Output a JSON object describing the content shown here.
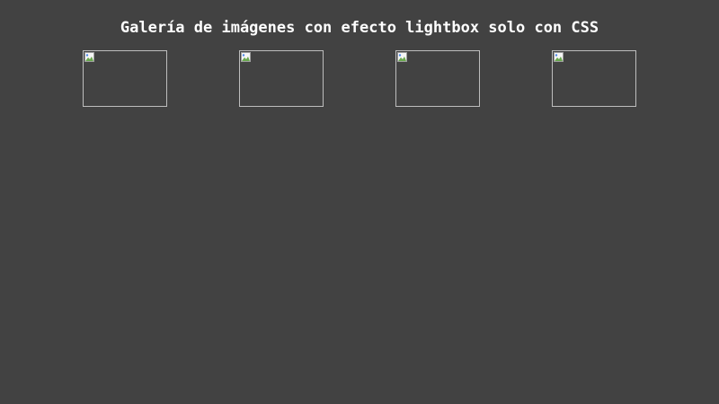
{
  "page": {
    "title": "Galería de imágenes con efecto lightbox solo con CSS",
    "background_color": "#424242",
    "text_color": "#ffffff"
  },
  "gallery": {
    "thumbnails": [
      {
        "icon": "broken-image-icon"
      },
      {
        "icon": "broken-image-icon"
      },
      {
        "icon": "broken-image-icon"
      },
      {
        "icon": "broken-image-icon"
      }
    ],
    "border_color": "#bdbdbd"
  }
}
